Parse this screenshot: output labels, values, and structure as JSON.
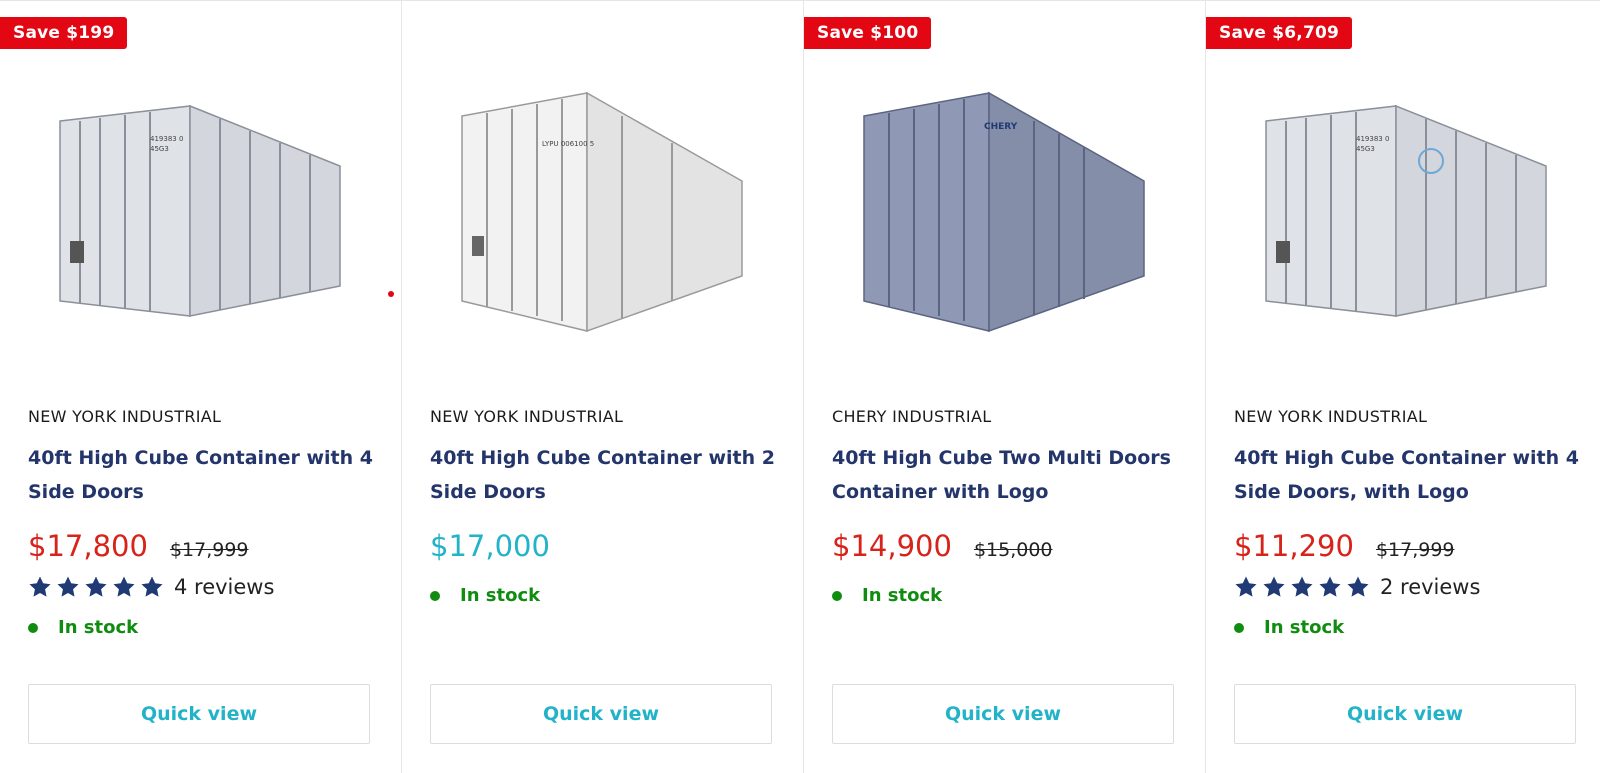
{
  "products": [
    {
      "badge": "Save $199",
      "vendor": "NEW YORK INDUSTRIAL",
      "title": "40ft High Cube Container with 4 Side Doors",
      "price": "$17,800",
      "compare_price": "$17,999",
      "rating_stars": 5,
      "reviews": "4 reviews",
      "stock": "In stock",
      "quick_view": "Quick view",
      "image_tone": "light-gray"
    },
    {
      "badge": "",
      "vendor": "NEW YORK INDUSTRIAL",
      "title": "40ft High Cube Container with 2 Side Doors",
      "price": "$17,000",
      "compare_price": "",
      "rating_stars": 0,
      "reviews": "",
      "stock": "In stock",
      "quick_view": "Quick view",
      "image_tone": "white"
    },
    {
      "badge": "Save $100",
      "vendor": "CHERY INDUSTRIAL",
      "title": "40ft High Cube Two Multi Doors Container with Logo",
      "price": "$14,900",
      "compare_price": "$15,000",
      "rating_stars": 0,
      "reviews": "",
      "stock": "In stock",
      "quick_view": "Quick view",
      "image_tone": "blue-gray",
      "logo_text": "CHERY"
    },
    {
      "badge": "Save $6,709",
      "vendor": "NEW YORK INDUSTRIAL",
      "title": "40ft High Cube Container with 4 Side Doors, with Logo",
      "price": "$11,290",
      "compare_price": "$17,999",
      "rating_stars": 5,
      "reviews": "2 reviews",
      "stock": "In stock",
      "quick_view": "Quick view",
      "image_tone": "light-gray"
    }
  ],
  "colors": {
    "badge": "#e30613",
    "sale_price": "#d7231a",
    "regular_price": "#22b3c9",
    "title": "#23356b",
    "stock": "#108c10",
    "star": "#1f3a75",
    "button_text": "#22b3c9"
  }
}
